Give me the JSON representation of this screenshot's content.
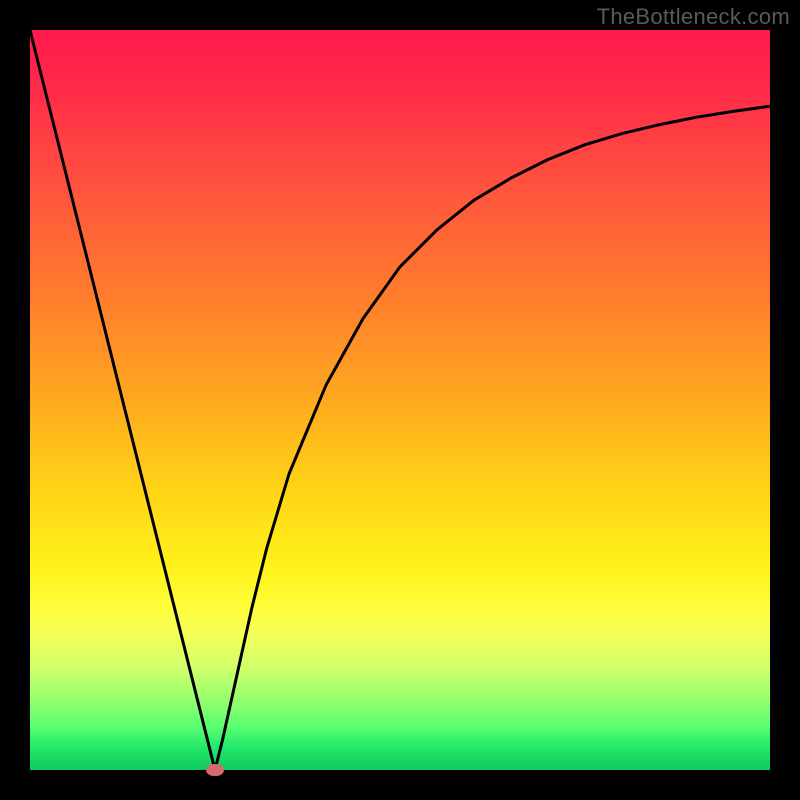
{
  "watermark": "TheBottleneck.com",
  "chart_data": {
    "type": "line",
    "title": "",
    "xlabel": "",
    "ylabel": "",
    "xlim": [
      0,
      100
    ],
    "ylim": [
      0,
      100
    ],
    "x": [
      0,
      2,
      4,
      6,
      8,
      10,
      12,
      14,
      16,
      18,
      20,
      22,
      24,
      25,
      26,
      28,
      30,
      32,
      35,
      40,
      45,
      50,
      55,
      60,
      65,
      70,
      75,
      80,
      85,
      90,
      95,
      100
    ],
    "values": [
      100,
      92,
      84,
      76,
      68,
      60,
      52,
      44,
      36,
      28,
      20,
      12,
      4,
      0,
      4,
      13,
      22,
      30,
      40,
      52,
      61,
      68,
      73,
      77,
      80,
      82.5,
      84.5,
      86,
      87.2,
      88.2,
      89,
      89.7
    ],
    "marker": {
      "x": 25,
      "y": 0
    },
    "colors": {
      "curve": "#000000",
      "marker": "#d46a6a",
      "gradient_top": "#ff1a4d",
      "gradient_bottom": "#0fc95e"
    }
  }
}
